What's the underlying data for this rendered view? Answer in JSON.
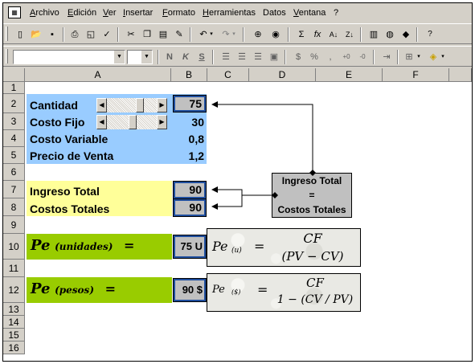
{
  "menu": {
    "items": [
      "Archivo",
      "Edición",
      "Ver",
      "Insertar",
      "Formato",
      "Herramientas",
      "Datos",
      "Ventana",
      "?"
    ]
  },
  "toolbar2": {
    "font_name_value": "",
    "font_size_value": ""
  },
  "columns": [
    "A",
    "B",
    "C",
    "D",
    "E",
    "F"
  ],
  "rows": [
    "1",
    "2",
    "3",
    "4",
    "5",
    "6",
    "7",
    "8",
    "9",
    "10",
    "11",
    "12",
    "13",
    "14",
    "15",
    "16"
  ],
  "cells": {
    "cantidad_label": "Cantidad",
    "cantidad_value": "75",
    "costo_fijo_label": "Costo Fijo",
    "costo_fijo_value": "30",
    "costo_variable_label": "Costo Variable",
    "costo_variable_value": "0,8",
    "precio_venta_label": "Precio de Venta",
    "precio_venta_value": "1,2",
    "ingreso_total_label": "Ingreso Total",
    "ingreso_total_value": "90",
    "costos_totales_label": "Costos Totales",
    "costos_totales_value": "90",
    "pe_unidades_value": "75 U",
    "pe_pesos_value": "90 $"
  },
  "callout": {
    "line1": "Ingreso Total",
    "line2": "=",
    "line3": "Costos Totales"
  },
  "pe_labels": {
    "unidades_main": "Pe",
    "unidades_sub": "(unidades)",
    "unidades_eq": "=",
    "pesos_main": "Pe",
    "pesos_sub": "(pesos)",
    "pesos_eq": "="
  },
  "formula_units": {
    "lhs": "Pe",
    "lhs_sub": "(u)",
    "eq": "=",
    "numerator": "CF",
    "denominator": "(PV − CV)"
  },
  "formula_pesos": {
    "lhs": "Pe",
    "lhs_sub": "($)",
    "eq": "=",
    "numerator": "CF",
    "denominator": "1 − (CV / PV)"
  },
  "colors": {
    "blue_fill": "#99ccff",
    "yellow_fill": "#ffff99",
    "green_fill": "#99cc00",
    "callout_fill": "#c0c0c0"
  }
}
